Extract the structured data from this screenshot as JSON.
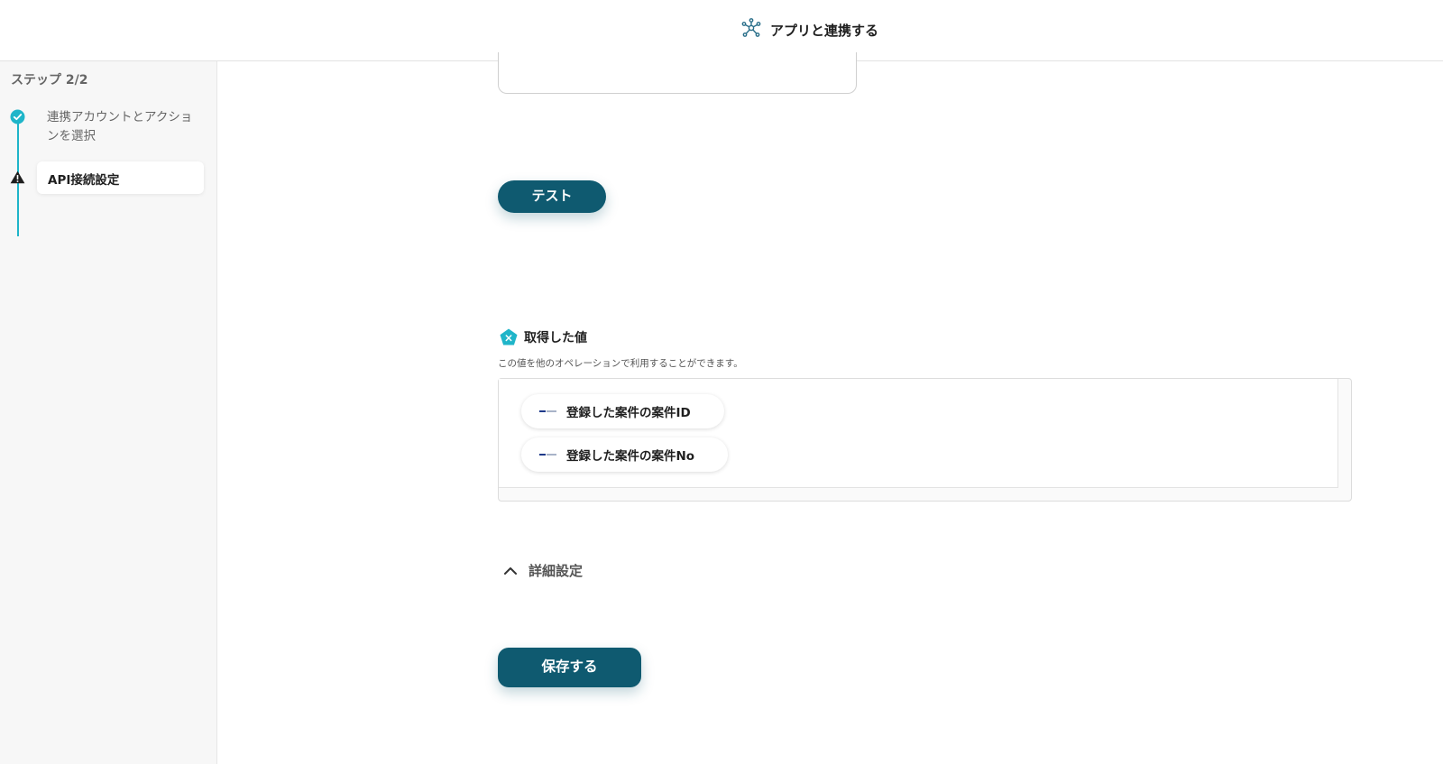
{
  "header": {
    "title": "アプリと連携する",
    "icon": "network-hub-icon"
  },
  "sidebar": {
    "step_label": "ステップ 2/2",
    "steps": [
      {
        "label": "連携アカウントとアクションを選択",
        "status": "complete",
        "icon": "check-circle-icon"
      },
      {
        "label": "API接続設定",
        "status": "warning",
        "icon": "warning-triangle-icon",
        "active": true
      }
    ],
    "accent_color": "#1fb5c9"
  },
  "main": {
    "test_button": "テスト",
    "retrieved": {
      "title": "取得した値",
      "icon": "pentagon-x-icon",
      "description": "この値を他のオペレーションで利用することができます。",
      "items": [
        {
          "label": "登録した案件の案件ID",
          "icon": "app-logo-icon"
        },
        {
          "label": "登録した案件の案件No",
          "icon": "app-logo-icon"
        }
      ]
    },
    "advanced_label": "詳細設定",
    "save_button": "保存する",
    "primary_color": "#0f5a70"
  }
}
